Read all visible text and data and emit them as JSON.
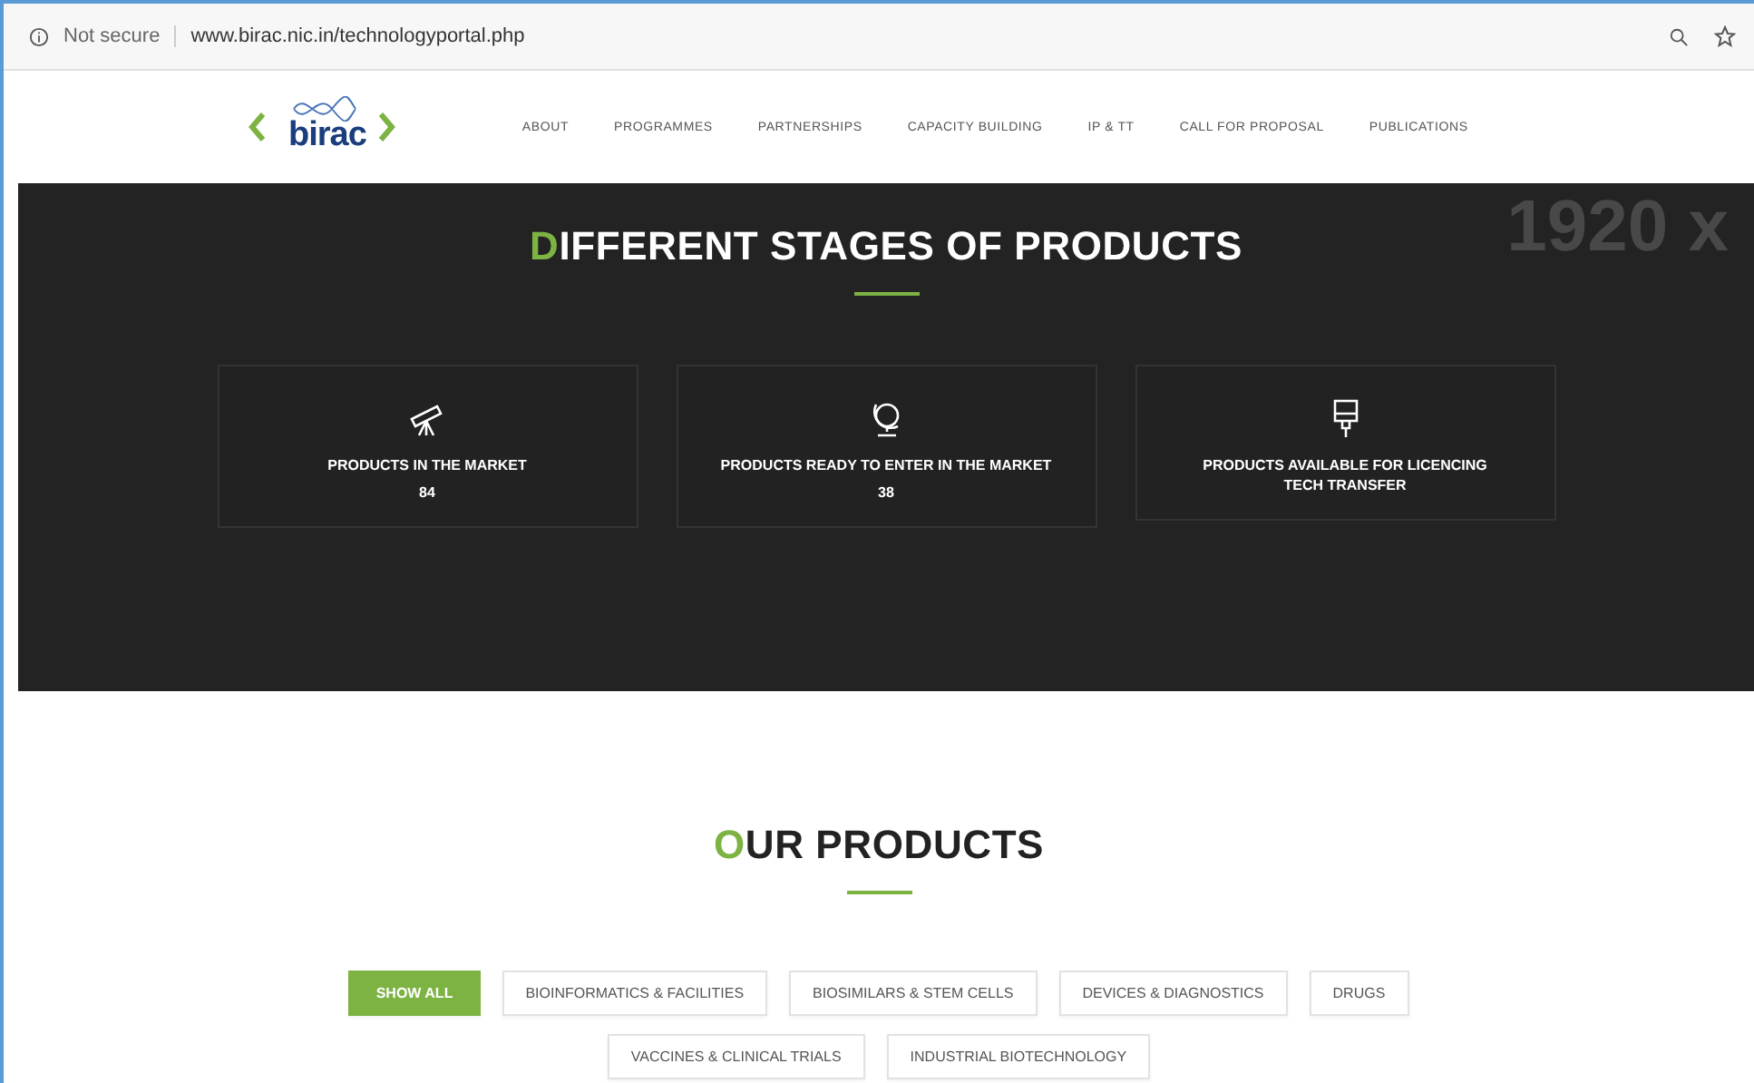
{
  "address_bar": {
    "security": "Not secure",
    "url": "www.birac.nic.in/technologyportal.php"
  },
  "nav": {
    "items": [
      "ABOUT",
      "PROGRAMMES",
      "PARTNERSHIPS",
      "CAPACITY BUILDING",
      "IP & TT",
      "CALL FOR PROPOSAL",
      "PUBLICATIONS"
    ],
    "logo": "birac"
  },
  "stages": {
    "title_first": "D",
    "title_rest": "IFFERENT STAGES OF PRODUCTS",
    "background_text": "1920 x",
    "cards": [
      {
        "kind": "telescope",
        "title": "PRODUCTS IN THE MARKET",
        "count": "84"
      },
      {
        "kind": "globe",
        "title": "PRODUCTS READY TO ENTER IN THE MARKET",
        "count": "38"
      },
      {
        "kind": "brush",
        "title": "PRODUCTS AVAILABLE FOR LICENCING",
        "subtitle": "TECH TRANSFER"
      }
    ]
  },
  "products": {
    "title_first": "O",
    "title_rest": "UR PRODUCTS",
    "filters": [
      {
        "label": "SHOW ALL",
        "selected": true
      },
      {
        "label": "BIOINFORMATICS & FACILITIES",
        "selected": false
      },
      {
        "label": "BIOSIMILARS & STEM CELLS",
        "selected": false
      },
      {
        "label": "DEVICES & DIAGNOSTICS",
        "selected": false
      },
      {
        "label": "DRUGS",
        "selected": false
      },
      {
        "label": "VACCINES & CLINICAL TRIALS",
        "selected": false
      },
      {
        "label": "INDUSTRIAL BIOTECHNOLOGY",
        "selected": false
      }
    ]
  }
}
